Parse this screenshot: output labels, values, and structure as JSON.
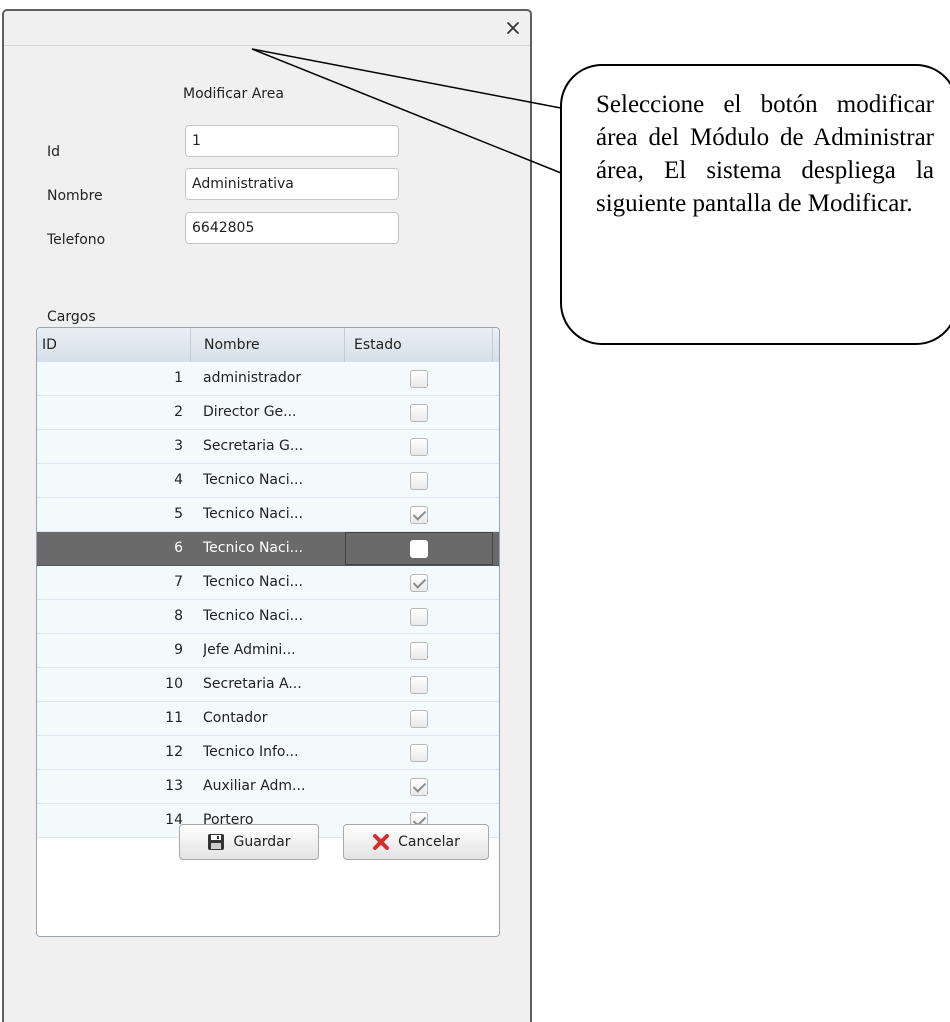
{
  "dialog": {
    "close_glyph": "×",
    "heading": "Modificar Area",
    "fields": {
      "id": {
        "label": "Id",
        "value": "1"
      },
      "nombre": {
        "label": "Nombre",
        "value": "Administrativa"
      },
      "telefono": {
        "label": "Telefono",
        "value": "6642805"
      }
    },
    "cargos_label": "Cargos",
    "table": {
      "headers": [
        "ID",
        "Nombre",
        "Estado"
      ],
      "rows": [
        {
          "id": "1",
          "nombre": "administrador",
          "estado": false
        },
        {
          "id": "2",
          "nombre": "Director Ge...",
          "estado": false
        },
        {
          "id": "3",
          "nombre": "Secretaria G...",
          "estado": false
        },
        {
          "id": "4",
          "nombre": "Tecnico Naci...",
          "estado": false
        },
        {
          "id": "5",
          "nombre": "Tecnico Naci...",
          "estado": true
        },
        {
          "id": "6",
          "nombre": "Tecnico Naci...",
          "estado": false,
          "selected": true
        },
        {
          "id": "7",
          "nombre": "Tecnico Naci...",
          "estado": true
        },
        {
          "id": "8",
          "nombre": "Tecnico Naci...",
          "estado": false
        },
        {
          "id": "9",
          "nombre": "Jefe Admini...",
          "estado": false
        },
        {
          "id": "10",
          "nombre": "Secretaria A...",
          "estado": false
        },
        {
          "id": "11",
          "nombre": "Contador",
          "estado": false
        },
        {
          "id": "12",
          "nombre": "Tecnico Info...",
          "estado": false
        },
        {
          "id": "13",
          "nombre": "Auxiliar Adm...",
          "estado": true
        },
        {
          "id": "14",
          "nombre": "Portero",
          "estado": true
        }
      ]
    },
    "buttons": {
      "guardar": "Guardar",
      "cancelar": "Cancelar"
    }
  },
  "callout": {
    "text": "Seleccione el botón modificar área del Módulo de Administrar área, El sistema despliega la siguiente pantalla de Modificar."
  },
  "colors": {
    "selected_row": "#6a6a6a",
    "cancel_icon": "#d32f2f",
    "save_icon": "#333333"
  }
}
